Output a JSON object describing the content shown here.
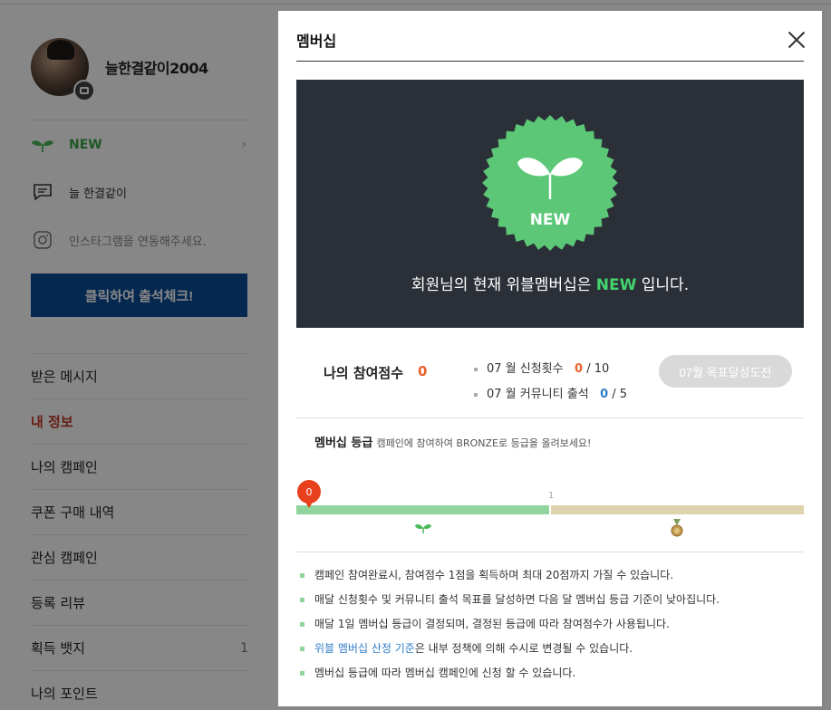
{
  "sidebar": {
    "username": "늘한결같이2004",
    "grade_label": "NEW",
    "blog_name": "늘 한결같이",
    "instagram_prompt": "인스타그램을 연동해주세요.",
    "attend_button": "클릭하여 출석체크!",
    "menu": [
      {
        "label": "받은 메시지",
        "active": false
      },
      {
        "label": "내 정보",
        "active": true
      },
      {
        "label": "나의 캠페인",
        "active": false
      },
      {
        "label": "쿠폰 구매 내역",
        "active": false
      },
      {
        "label": "관심 캠페인",
        "active": false
      },
      {
        "label": "등록 리뷰",
        "active": false
      },
      {
        "label": "획득 뱃지",
        "active": false,
        "count": "1"
      },
      {
        "label": "나의 포인트",
        "active": false
      }
    ]
  },
  "modal": {
    "title": "멤버십",
    "badge_label": "NEW",
    "hero_prefix": "회원님의 현재 위블멤버십은",
    "hero_grade": "NEW",
    "hero_suffix": "입니다.",
    "score_label": "나의 참여점수",
    "score_value": "0",
    "stats": [
      {
        "label": "07 월 신청횟수",
        "current": "0",
        "total": "/ 10"
      },
      {
        "label": "07 월 커뮤니티 출석",
        "current": "0",
        "total": "/ 5"
      }
    ],
    "challenge_button": "07월 목표달성도전",
    "grade_title": "멤버십 등급",
    "grade_subtitle": "캠페인에 참여하여 BRONZE로 등급을 올려보세요!",
    "progress": {
      "current": "0",
      "step_label": "1",
      "fraction": 0.0
    },
    "notes_plain_0": "캠페인 참여완료시, 참여점수 1점을 획득하며 최대 20점까지 가질 수 있습니다.",
    "notes_plain_1": "매달 신청횟수 및 커뮤니티 출석 목표를 달성하면 다음 달 멤버십 등급 기준이 낮아집니다.",
    "notes_plain_2": "매달 1일 멤버십 등급이 결정되며, 결정된 등급에 따라 참여점수가 사용됩니다.",
    "notes_link": "위블 멤버십 산정 기준",
    "notes_link_suffix": "은 내부 정책에 의해 수시로 변경될 수 있습니다.",
    "notes_plain_4": "멤버십 등급에 따라 멤버십 캠페인에 신청 할 수 있습니다."
  },
  "colors": {
    "accent_green": "#44d36c",
    "badge_green": "#5cc877",
    "hero_bg": "#2b3038",
    "score_orange": "#e8622a",
    "link_blue": "#2f7ec9",
    "attend_blue": "#0b4d9a",
    "marker_red": "#e8401c"
  }
}
